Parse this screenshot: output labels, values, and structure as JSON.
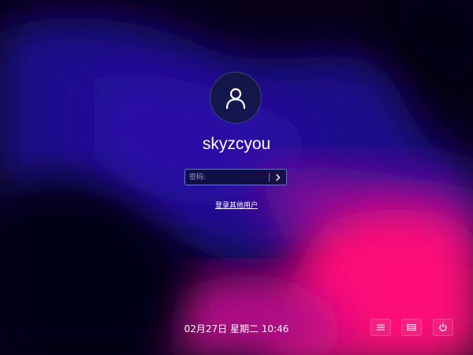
{
  "login": {
    "username": "skyzcyou",
    "avatar_icon": "user-icon",
    "password_placeholder": "密码:",
    "submit_icon": "chevron-right-icon",
    "other_user_link": "登录其他用户"
  },
  "status": {
    "datetime": "02月27日 星期二 10:46"
  },
  "corner_buttons": [
    {
      "name": "session-menu",
      "icon": "hamburger-menu-icon"
    },
    {
      "name": "keyboard-layout",
      "icon": "keyboard-icon"
    },
    {
      "name": "power",
      "icon": "power-icon"
    }
  ],
  "colors": {
    "accent_border": "#4c7fd8",
    "wallpaper_blue": "#1f0f8a",
    "wallpaper_magenta": "#ff0a7a",
    "wallpaper_dark": "#070017"
  }
}
